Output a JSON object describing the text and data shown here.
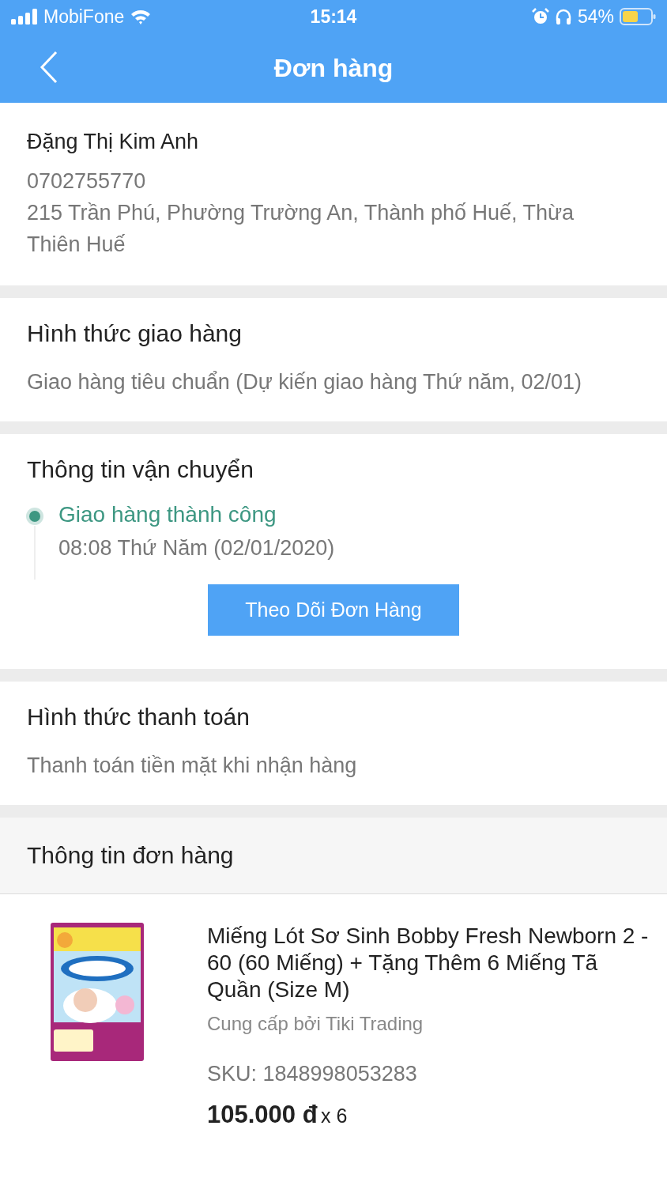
{
  "status_bar": {
    "carrier": "MobiFone",
    "time": "15:14",
    "battery": "54%"
  },
  "header": {
    "title": "Đơn hàng"
  },
  "recipient": {
    "name": "Đặng Thị Kim Anh",
    "phone": "0702755770",
    "address": "215 Trần Phú, Phường Trường An, Thành phố Huế, Thừa Thiên Huế"
  },
  "shipping_method": {
    "title": "Hình thức giao hàng",
    "value": "Giao hàng tiêu chuẩn (Dự kiến giao hàng Thứ năm, 02/01)"
  },
  "tracking": {
    "title": "Thông tin vận chuyển",
    "events": [
      {
        "status": "Giao hàng thành công",
        "time": "08:08 Thứ Năm (02/01/2020)",
        "color": "#3d9782"
      }
    ],
    "button": "Theo Dõi Đơn Hàng"
  },
  "payment": {
    "title": "Hình thức thanh toán",
    "value": "Thanh toán tiền mặt khi nhận hàng"
  },
  "order": {
    "title": "Thông tin đơn hàng",
    "items": [
      {
        "name": "Miếng Lót Sơ Sinh Bobby Fresh Newborn 2 - 60 (60 Miếng) + Tặng Thêm 6 Miếng Tã Quần (Size M)",
        "seller": "Cung cấp bởi Tiki Trading",
        "sku": "SKU: 1848998053283",
        "price": "105.000 đ",
        "quantity": "x 6"
      }
    ]
  }
}
